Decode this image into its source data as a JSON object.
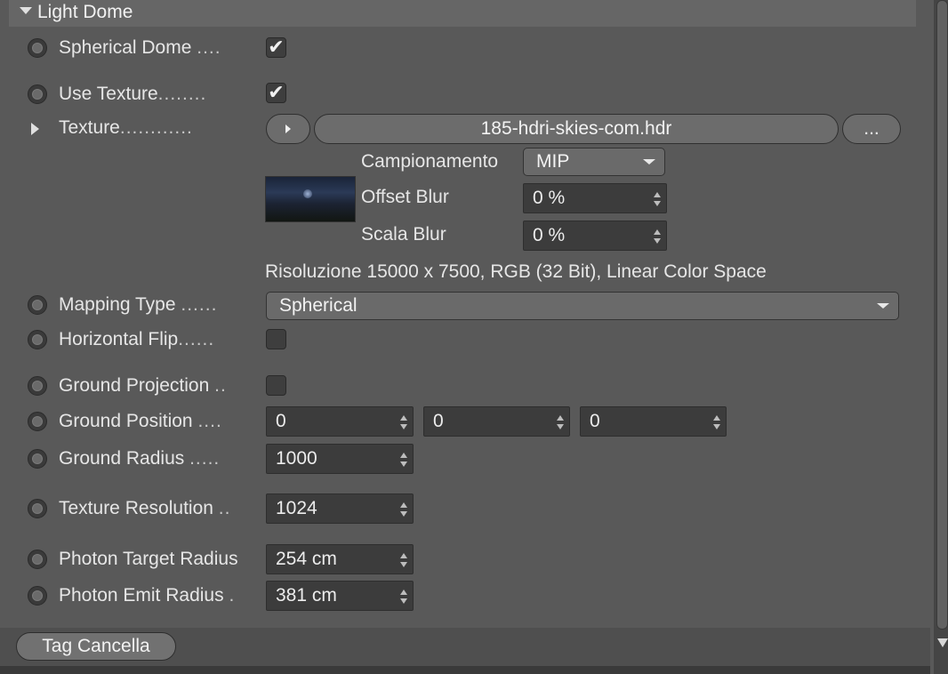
{
  "section": {
    "title": "Light Dome"
  },
  "rows": {
    "spherical_dome": {
      "label": "Spherical Dome",
      "dots": "....",
      "checked": true
    },
    "use_texture": {
      "label": "Use Texture",
      "dots": "........",
      "checked": true
    },
    "texture": {
      "label": "Texture",
      "dots": "............",
      "filename": "185-hdri-skies-com.hdr",
      "browse": "..."
    },
    "campionamento": {
      "label": "Campionamento",
      "value": "MIP"
    },
    "offset_blur": {
      "label": "Offset Blur",
      "value": "0 %"
    },
    "scala_blur": {
      "label": "Scala Blur",
      "value": "0 %"
    },
    "resolution_info": "Risoluzione 15000 x 7500, RGB (32 Bit), Linear Color Space",
    "mapping_type": {
      "label": "Mapping Type",
      "dots": "......",
      "value": "Spherical"
    },
    "horizontal_flip": {
      "label": "Horizontal Flip",
      "dots": "......",
      "checked": false
    },
    "ground_projection": {
      "label": "Ground Projection",
      "dots": "..",
      "checked": false
    },
    "ground_position": {
      "label": "Ground Position",
      "dots": "....",
      "x": "0",
      "y": "0",
      "z": "0"
    },
    "ground_radius": {
      "label": "Ground Radius",
      "dots": ".....",
      "value": "1000"
    },
    "texture_resolution": {
      "label": "Texture Resolution",
      "dots": "..",
      "value": "1024"
    },
    "photon_target_radius": {
      "label": "Photon Target Radius",
      "value": "254 cm"
    },
    "photon_emit_radius": {
      "label": "Photon Emit Radius",
      "dots": ".",
      "value": "381 cm"
    }
  },
  "footer": {
    "button_label": "Tag Cancella"
  },
  "icons": {
    "checkmark": "✔",
    "expand": "triangle-right",
    "collapse": "triangle-down"
  }
}
